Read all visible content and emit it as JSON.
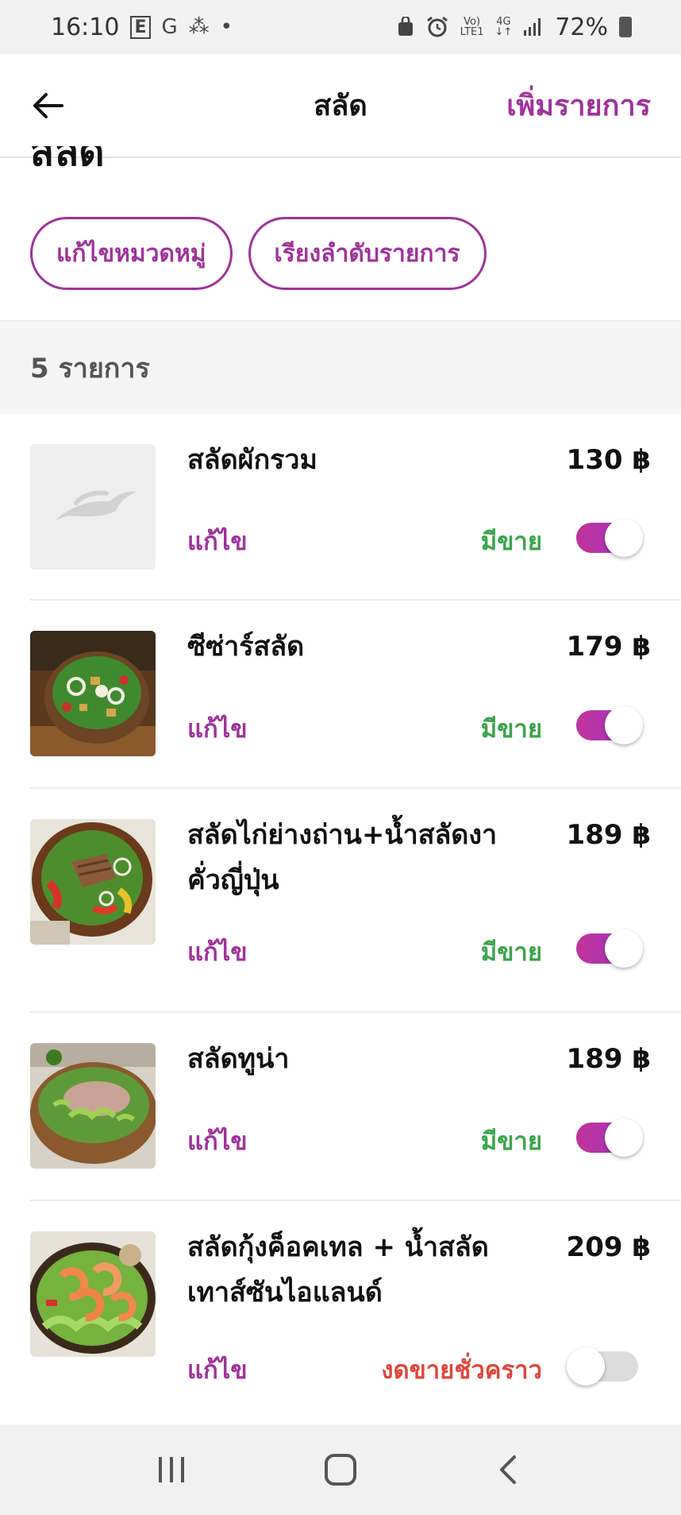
{
  "status_bar": {
    "time": "16:10",
    "left_icons": [
      "E",
      "G",
      "⁂",
      "•"
    ],
    "network_top": "Vo)",
    "network_bottom": "LTE1",
    "data_top": "4G",
    "data_bottom": "↓↑",
    "battery": "72%"
  },
  "header": {
    "title": "สลัด",
    "add_label": "เพิ่มรายการ"
  },
  "category_title": "สลัด",
  "chips": {
    "edit_category": "แก้ไขหมวดหมู่",
    "sort_items": "เรียงลำดับรายการ"
  },
  "item_count": "5 รายการ",
  "items": [
    {
      "name": "สลัดผักรวม",
      "price": "130 ฿",
      "edit": "แก้ไข",
      "status": "มีขาย",
      "available": true,
      "image": "placeholder-logo"
    },
    {
      "name": "ซีซ่าร์สลัด",
      "price": "179 ฿",
      "edit": "แก้ไข",
      "status": "มีขาย",
      "available": true,
      "image": "caesar-salad-photo"
    },
    {
      "name": "สลัดไก่ย่างถ่าน+น้ำสลัดงาคั่วญี่ปุ่น",
      "price": "189 ฿",
      "edit": "แก้ไข",
      "status": "มีขาย",
      "available": true,
      "image": "grilled-chicken-salad-photo"
    },
    {
      "name": "สลัดทูน่า",
      "price": "189 ฿",
      "edit": "แก้ไข",
      "status": "มีขาย",
      "available": true,
      "image": "tuna-salad-photo"
    },
    {
      "name": "สลัดกุ้งค็อคเทล + น้ำสลัดเทาส์ซันไอแลนด์",
      "price": "209 ฿",
      "edit": "แก้ไข",
      "status": "งดขายชั่วคราว",
      "available": false,
      "image": "shrimp-cocktail-salad-photo"
    }
  ],
  "colors": {
    "accent": "#a0329c",
    "available": "#3aa54a",
    "unavailable": "#e0463a"
  },
  "nav": [
    "recent-apps-icon",
    "home-icon",
    "back-nav-icon"
  ]
}
